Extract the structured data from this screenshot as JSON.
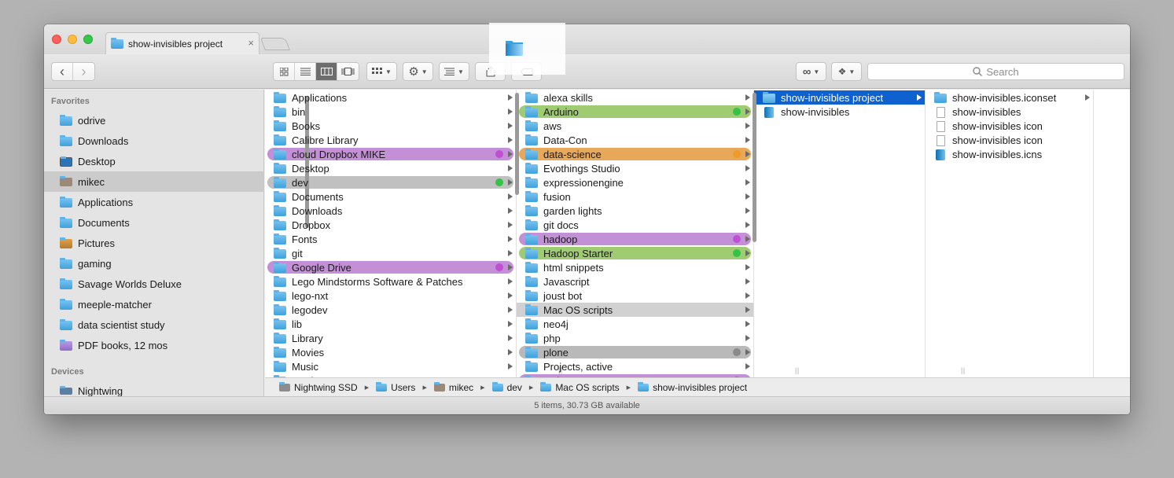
{
  "window": {
    "tab_title": "show-invisibles project",
    "tab_close": "×",
    "status": "5 items, 30.73 GB available"
  },
  "toolbar": {
    "back": "‹",
    "forward": "›",
    "search_placeholder": "Search",
    "view_mode": "columns"
  },
  "sidebar": {
    "favorites_header": "Favorites",
    "favorites": [
      {
        "label": "odrive",
        "icon": "folder-icon"
      },
      {
        "label": "Downloads",
        "icon": "downloads-icon"
      },
      {
        "label": "Desktop",
        "icon": "desktop-icon"
      },
      {
        "label": "mikec",
        "icon": "home-icon",
        "selected": true
      },
      {
        "label": "Applications",
        "icon": "applications-icon"
      },
      {
        "label": "Documents",
        "icon": "documents-icon"
      },
      {
        "label": "Pictures",
        "icon": "pictures-icon"
      },
      {
        "label": "gaming",
        "icon": "folder-icon"
      },
      {
        "label": "Savage Worlds Deluxe",
        "icon": "folder-icon"
      },
      {
        "label": "meeple-matcher",
        "icon": "folder-icon"
      },
      {
        "label": "data scientist study",
        "icon": "folder-icon"
      },
      {
        "label": "PDF books, 12 mos",
        "icon": "folder-purple-icon"
      }
    ],
    "devices_header": "Devices",
    "devices": [
      {
        "label": "Nightwing",
        "icon": "laptop-icon"
      }
    ]
  },
  "tag_colors": {
    "purple": "#c38fd6",
    "green": "#9fcb72",
    "orange": "#e8a85a",
    "gray": "#b9b9b9",
    "purple_dot": "#c04fd6",
    "green_dot": "#34c247",
    "orange_dot": "#f09a2a",
    "gray_dot": "#8a8a8a"
  },
  "columns": [
    {
      "items": [
        {
          "label": "Applications"
        },
        {
          "label": "bin"
        },
        {
          "label": "Books"
        },
        {
          "label": "Calibre Library"
        },
        {
          "label": "cloud Dropbox MIKE",
          "tag": "purple"
        },
        {
          "label": "Desktop"
        },
        {
          "label": "dev",
          "tag": "green",
          "selected": true
        },
        {
          "label": "Documents"
        },
        {
          "label": "Downloads"
        },
        {
          "label": "Dropbox"
        },
        {
          "label": "Fonts"
        },
        {
          "label": "git"
        },
        {
          "label": "Google Drive",
          "tag": "purple"
        },
        {
          "label": "Lego Mindstorms Software & Patches"
        },
        {
          "label": "lego-nxt"
        },
        {
          "label": "legodev"
        },
        {
          "label": "lib"
        },
        {
          "label": "Library"
        },
        {
          "label": "Movies"
        },
        {
          "label": "Music"
        },
        {
          "label": "Music ..."
        }
      ]
    },
    {
      "items": [
        {
          "label": "alexa skills"
        },
        {
          "label": "Arduino",
          "tag": "green"
        },
        {
          "label": "aws"
        },
        {
          "label": "Data-Con"
        },
        {
          "label": "data-science",
          "tag": "orange"
        },
        {
          "label": "Evothings Studio"
        },
        {
          "label": "expressionengine"
        },
        {
          "label": "fusion"
        },
        {
          "label": "garden lights"
        },
        {
          "label": "git docs"
        },
        {
          "label": "hadoop",
          "tag": "purple"
        },
        {
          "label": "Hadoop Starter",
          "tag": "green"
        },
        {
          "label": "html snippets"
        },
        {
          "label": "Javascript"
        },
        {
          "label": "joust bot"
        },
        {
          "label": "Mac OS scripts",
          "selected": true
        },
        {
          "label": "neo4j"
        },
        {
          "label": "php"
        },
        {
          "label": "plone",
          "tag": "gray"
        },
        {
          "label": "Projects, active"
        },
        {
          "label": "python",
          "tag": "purple"
        }
      ]
    },
    {
      "items": [
        {
          "label": "show-invisibles project",
          "selected_active": true
        },
        {
          "label": "show-invisibles",
          "icon": "app"
        }
      ]
    },
    {
      "items": [
        {
          "label": "show-invisibles.iconset",
          "folder": true
        },
        {
          "label": "show-invisibles",
          "icon": "doc"
        },
        {
          "label": "show-invisibles icon",
          "icon": "doc"
        },
        {
          "label": "show-invisibles icon",
          "icon": "doc"
        },
        {
          "label": "show-invisibles.icns",
          "icon": "icns"
        }
      ]
    }
  ],
  "pathbar": [
    {
      "label": "Nightwing SSD"
    },
    {
      "label": "Users"
    },
    {
      "label": "mikec"
    },
    {
      "label": "dev"
    },
    {
      "label": "Mac OS scripts"
    },
    {
      "label": "show-invisibles project"
    }
  ]
}
